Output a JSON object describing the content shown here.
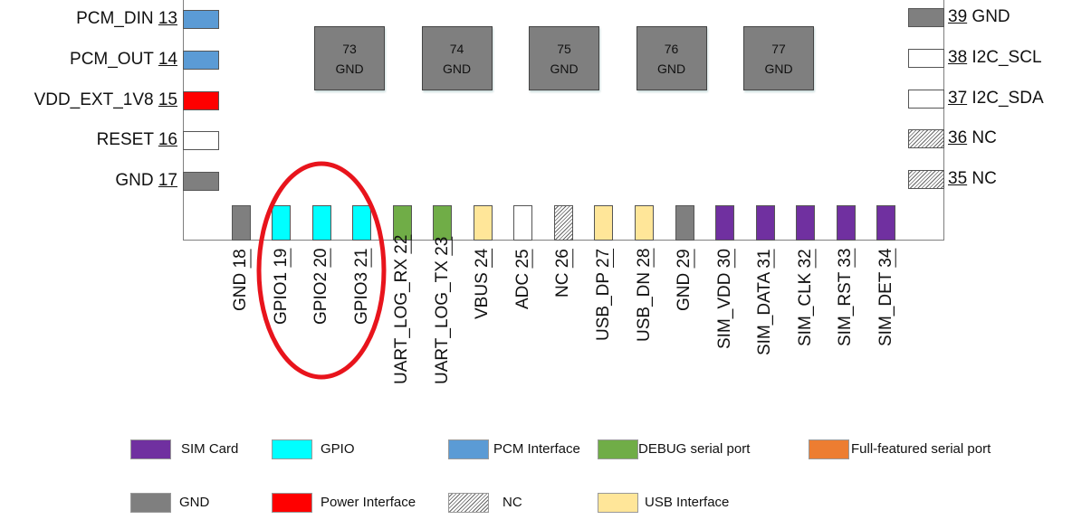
{
  "colors": {
    "SIM Card": "#7030a0",
    "GPIO": "#00ffff",
    "PCM Interface": "#5b9bd5",
    "DEBUG serial port": "#70ad47",
    "Full-featured serial port": "#ed7d31",
    "GND": "#7f7f7f",
    "Power Interface": "#ff0000",
    "NC": "hatch",
    "USB Interface": "#ffe699",
    "Other": "#ffffff",
    "highlight": "#e8141c"
  },
  "left_pins": [
    {
      "num": "13",
      "name": "PCM_DIN",
      "type": "PCM Interface"
    },
    {
      "num": "14",
      "name": "PCM_OUT",
      "type": "PCM Interface"
    },
    {
      "num": "15",
      "name": "VDD_EXT_1V8",
      "type": "Power Interface"
    },
    {
      "num": "16",
      "name": "RESET",
      "type": "Other"
    },
    {
      "num": "17",
      "name": "GND",
      "type": "GND"
    }
  ],
  "right_pins": [
    {
      "num": "39",
      "name": "GND",
      "type": "GND"
    },
    {
      "num": "38",
      "name": "I2C_SCL",
      "type": "Other"
    },
    {
      "num": "37",
      "name": "I2C_SDA",
      "type": "Other"
    },
    {
      "num": "36",
      "name": "NC",
      "type": "NC"
    },
    {
      "num": "35",
      "name": "NC",
      "type": "NC"
    }
  ],
  "bottom_pins": [
    {
      "num": "18",
      "name": "GND",
      "type": "GND"
    },
    {
      "num": "19",
      "name": "GPIO1",
      "type": "GPIO"
    },
    {
      "num": "20",
      "name": "GPIO2",
      "type": "GPIO"
    },
    {
      "num": "21",
      "name": "GPIO3",
      "type": "GPIO"
    },
    {
      "num": "22",
      "name": "UART_LOG_RX",
      "type": "DEBUG serial port"
    },
    {
      "num": "23",
      "name": "UART_LOG_TX",
      "type": "DEBUG serial port"
    },
    {
      "num": "24",
      "name": "VBUS",
      "type": "USB Interface"
    },
    {
      "num": "25",
      "name": "ADC",
      "type": "Other"
    },
    {
      "num": "26",
      "name": "NC",
      "type": "NC"
    },
    {
      "num": "27",
      "name": "USB_DP",
      "type": "USB Interface"
    },
    {
      "num": "28",
      "name": "USB_DN",
      "type": "USB Interface"
    },
    {
      "num": "29",
      "name": "GND",
      "type": "GND"
    },
    {
      "num": "30",
      "name": "SIM_VDD",
      "type": "SIM Card"
    },
    {
      "num": "31",
      "name": "SIM_DATA",
      "type": "SIM Card"
    },
    {
      "num": "32",
      "name": "SIM_CLK",
      "type": "SIM Card"
    },
    {
      "num": "33",
      "name": "SIM_RST",
      "type": "SIM Card"
    },
    {
      "num": "34",
      "name": "SIM_DET",
      "type": "SIM Card"
    }
  ],
  "gnd_pads": [
    {
      "num": "73",
      "name": "GND"
    },
    {
      "num": "74",
      "name": "GND"
    },
    {
      "num": "75",
      "name": "GND"
    },
    {
      "num": "76",
      "name": "GND"
    },
    {
      "num": "77",
      "name": "GND"
    }
  ],
  "highlighted_pins": [
    "19",
    "20",
    "21"
  ],
  "legend": [
    {
      "label": "SIM Card",
      "type": "SIM Card"
    },
    {
      "label": "GPIO",
      "type": "GPIO"
    },
    {
      "label": "PCM Interface",
      "type": "PCM Interface"
    },
    {
      "label": "DEBUG serial port",
      "type": "DEBUG serial port"
    },
    {
      "label": "Full-featured serial port",
      "type": "Full-featured serial port"
    },
    {
      "label": "GND",
      "type": "GND"
    },
    {
      "label": "Power Interface",
      "type": "Power Interface"
    },
    {
      "label": "NC",
      "type": "NC"
    },
    {
      "label": "USB Interface",
      "type": "USB Interface"
    }
  ]
}
